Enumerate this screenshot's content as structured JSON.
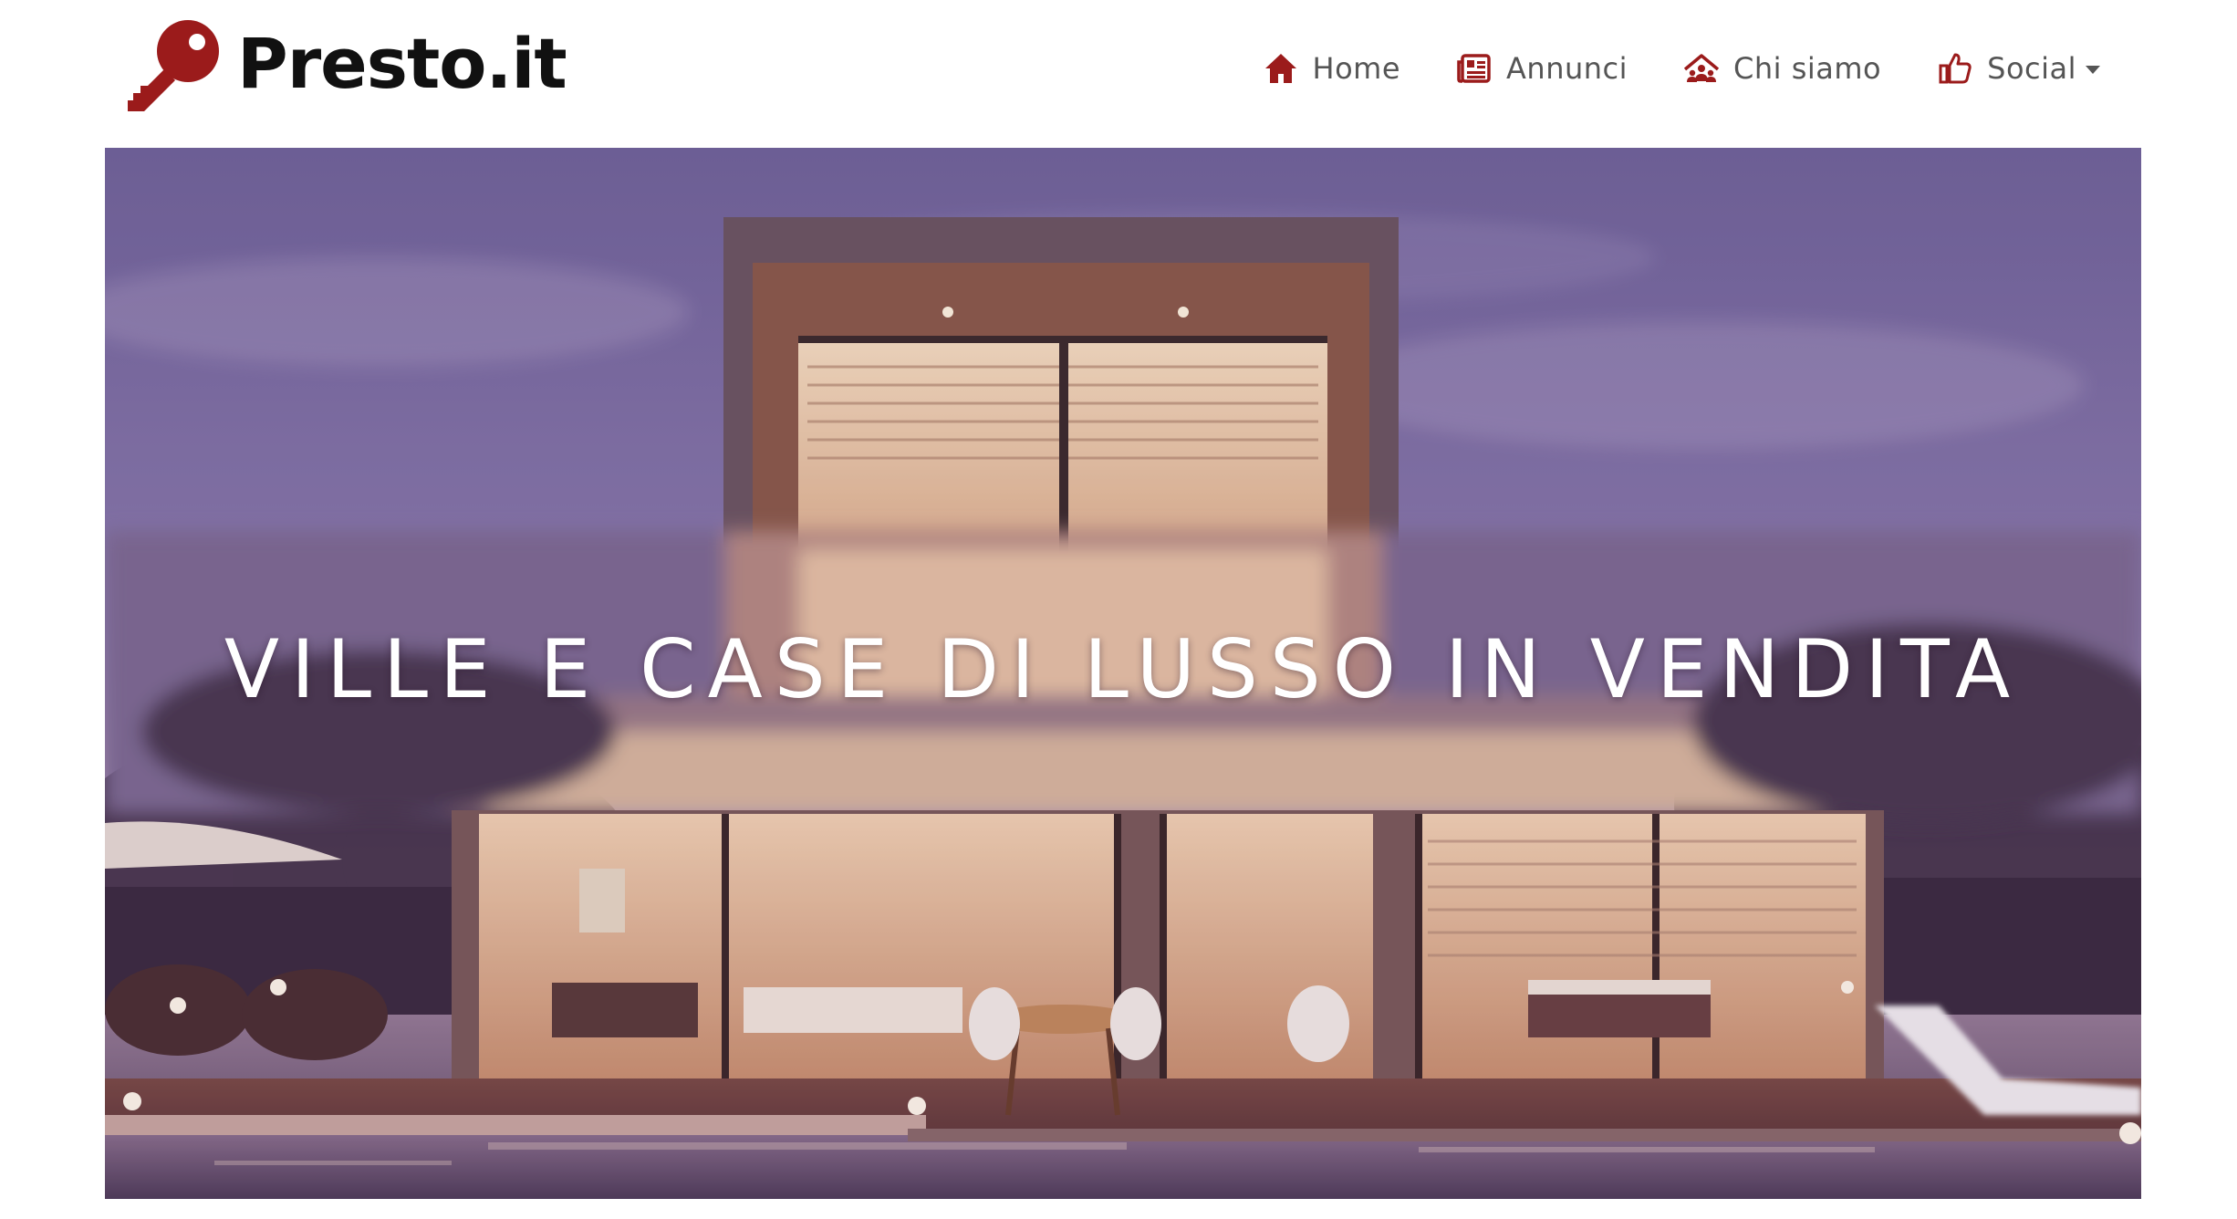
{
  "brand": {
    "name": "Presto.it",
    "logo_icon": "key-icon",
    "accent_color": "#9b1b1b"
  },
  "nav": {
    "items": [
      {
        "label": "Home",
        "icon": "home-icon"
      },
      {
        "label": "Annunci",
        "icon": "newspaper-icon"
      },
      {
        "label": "Chi siamo",
        "icon": "team-icon"
      },
      {
        "label": "Social",
        "icon": "thumbs-up-icon",
        "dropdown": true
      }
    ],
    "text_color": "#555555",
    "icon_color": "#9b1b1b"
  },
  "hero": {
    "title": "VILLE E CASE DI LUSSO IN VENDITA",
    "image": "modern-villa-at-dusk-with-pool"
  }
}
